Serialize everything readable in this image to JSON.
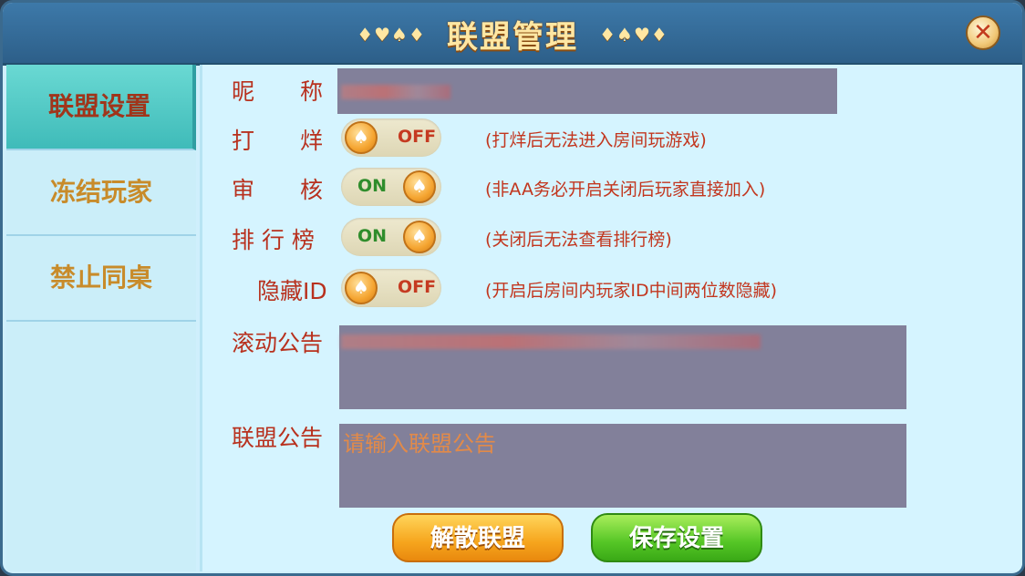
{
  "header": {
    "title": "联盟管理",
    "suits_left": "♦♥♠♦",
    "suits_right": "♦♠♥♦",
    "close_icon": "✕"
  },
  "sidebar": {
    "items": [
      {
        "label": "联盟设置",
        "active": true
      },
      {
        "label": "冻结玩家",
        "active": false
      },
      {
        "label": "禁止同桌",
        "active": false
      }
    ]
  },
  "form": {
    "nickname_label": "昵　　称",
    "ban_label": "打　　烊",
    "ban_state": "OFF",
    "ban_hint": "(打烊后无法进入房间玩游戏)",
    "audit_label": "审　　核",
    "audit_state": "ON",
    "audit_hint": "(非AA务必开启关闭后玩家直接加入)",
    "rank_label": "排 行 榜",
    "rank_state": "ON",
    "rank_hint": "(关闭后无法查看排行榜)",
    "hideid_label": "隐藏ID",
    "hideid_state": "OFF",
    "hideid_hint": "(开启后房间内玩家ID中间两位数隐藏)",
    "scroll_notice_label": "滚动公告",
    "alliance_notice_label": "联盟公告",
    "alliance_notice_placeholder": "请输入联盟公告"
  },
  "buttons": {
    "dissolve": "解散联盟",
    "save": "保存设置"
  },
  "icons": {
    "toggle_knob": "spade-icon",
    "close": "close-icon"
  },
  "colors": {
    "accent_red": "#b8311e",
    "on_green": "#2f8d2c",
    "knob_orange": "#f5a531"
  }
}
